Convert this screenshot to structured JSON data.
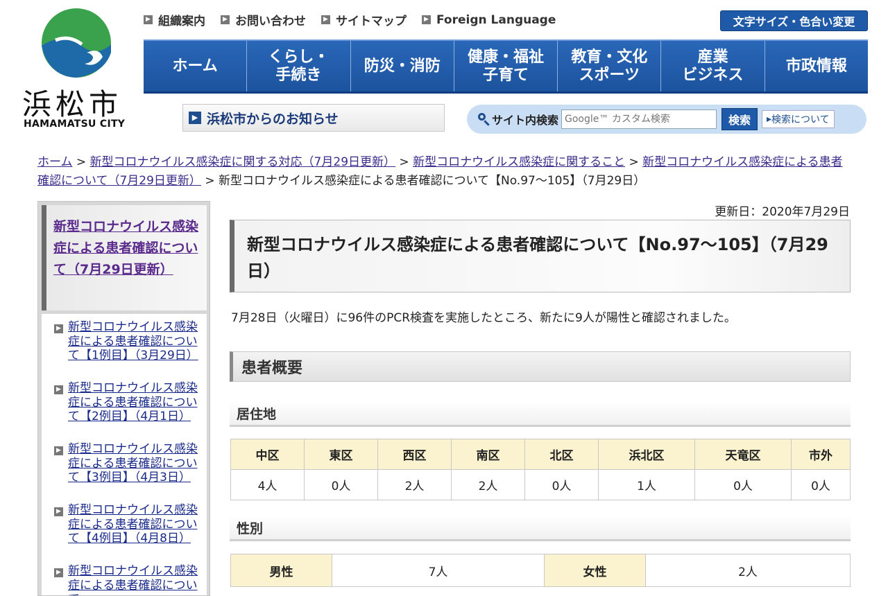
{
  "logo": {
    "title": "浜松市",
    "subtitle": "HAMAMATSU CITY",
    "colors": {
      "green": "#3aa14d",
      "blue": "#1e6aa8"
    }
  },
  "toplinks": [
    {
      "label": "組織案内"
    },
    {
      "label": "お問い合わせ"
    },
    {
      "label": "サイトマップ"
    },
    {
      "label": "Foreign Language"
    }
  ],
  "fontsize_button": "文字サイズ・色合い変更",
  "nav": [
    {
      "label": "ホーム"
    },
    {
      "label": "くらし・\n手続き"
    },
    {
      "label": "防災・消防"
    },
    {
      "label": "健康・福祉\n子育て"
    },
    {
      "label": "教育・文化\nスポーツ"
    },
    {
      "label": "産業\nビジネス"
    },
    {
      "label": "市政情報"
    }
  ],
  "notice": {
    "label": "浜松市からのお知らせ"
  },
  "search": {
    "label": "サイト内検索",
    "placeholder": "Google™ カスタム検索",
    "button": "検索",
    "about": "検索について"
  },
  "breadcrumb": {
    "items": [
      "ホーム",
      "新型コロナウイルス感染症に関する対応（7月29日更新）",
      "新型コロナウイルス感染症に関すること",
      "新型コロナウイルス感染症による患者確認について（7月29日更新）"
    ],
    "sep": " > ",
    "current": "新型コロナウイルス感染症による患者確認について【No.97〜105】（7月29日）"
  },
  "sidebar": {
    "heading": "新型コロナウイルス感染症による患者確認について（7月29日更新）",
    "items": [
      "新型コロナウイルス感染症による患者確認について【1例目】（3月29日）",
      "新型コロナウイルス感染症による患者確認について【2例目】（4月1日）",
      "新型コロナウイルス感染症による患者確認について【3例目】（4月3日）",
      "新型コロナウイルス感染症による患者確認について【4例目】（4月8日）",
      "新型コロナウイルス感染症による患者確認について"
    ]
  },
  "main": {
    "updated": "更新日：2020年7月29日",
    "title": "新型コロナウイルス感染症による患者確認について【No.97〜105】（7月29日）",
    "intro": "7月28日（火曜日）に96件のPCR検査を実施したところ、新たに9人が陽性と確認されました。",
    "summary_heading": "患者概要",
    "residence": {
      "heading": "居住地",
      "headers": [
        "中区",
        "東区",
        "西区",
        "南区",
        "北区",
        "浜北区",
        "天竜区",
        "市外"
      ],
      "values": [
        "4人",
        "0人",
        "2人",
        "2人",
        "0人",
        "1人",
        "0人",
        "0人"
      ]
    },
    "sex": {
      "heading": "性別",
      "male_label": "男性",
      "male_value": "7人",
      "female_label": "女性",
      "female_value": "2人"
    }
  }
}
